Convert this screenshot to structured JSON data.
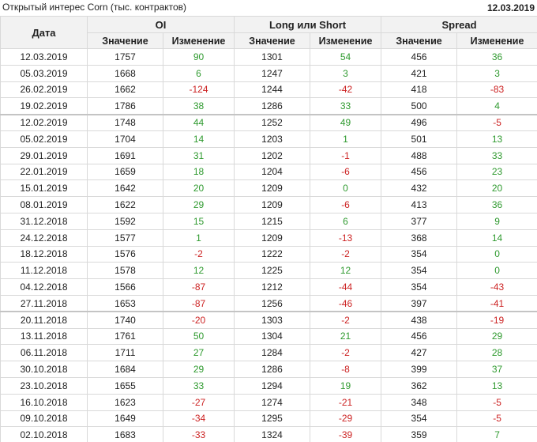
{
  "header": {
    "title": "Открытый интерес Corn (тыс. контрактов)",
    "date": "12.03.2019"
  },
  "columns": {
    "date": "Дата",
    "groups": [
      "OI",
      "Long или Short",
      "Spread"
    ],
    "value": "Значение",
    "change": "Изменение"
  },
  "colors": {
    "positive": "#2f9a2f",
    "negative": "#cc2222",
    "header_bg": "#f2f2f2",
    "grid": "#d9d9d9"
  },
  "group_separators_after_rows": [
    3,
    15
  ],
  "rows": [
    [
      "12.03.2019",
      "1757",
      "90",
      "1301",
      "54",
      "456",
      "36"
    ],
    [
      "05.03.2019",
      "1668",
      "6",
      "1247",
      "3",
      "421",
      "3"
    ],
    [
      "26.02.2019",
      "1662",
      "-124",
      "1244",
      "-42",
      "418",
      "-83"
    ],
    [
      "19.02.2019",
      "1786",
      "38",
      "1286",
      "33",
      "500",
      "4"
    ],
    [
      "12.02.2019",
      "1748",
      "44",
      "1252",
      "49",
      "496",
      "-5"
    ],
    [
      "05.02.2019",
      "1704",
      "14",
      "1203",
      "1",
      "501",
      "13"
    ],
    [
      "29.01.2019",
      "1691",
      "31",
      "1202",
      "-1",
      "488",
      "33"
    ],
    [
      "22.01.2019",
      "1659",
      "18",
      "1204",
      "-6",
      "456",
      "23"
    ],
    [
      "15.01.2019",
      "1642",
      "20",
      "1209",
      "0",
      "432",
      "20"
    ],
    [
      "08.01.2019",
      "1622",
      "29",
      "1209",
      "-6",
      "413",
      "36"
    ],
    [
      "31.12.2018",
      "1592",
      "15",
      "1215",
      "6",
      "377",
      "9"
    ],
    [
      "24.12.2018",
      "1577",
      "1",
      "1209",
      "-13",
      "368",
      "14"
    ],
    [
      "18.12.2018",
      "1576",
      "-2",
      "1222",
      "-2",
      "354",
      "0"
    ],
    [
      "11.12.2018",
      "1578",
      "12",
      "1225",
      "12",
      "354",
      "0"
    ],
    [
      "04.12.2018",
      "1566",
      "-87",
      "1212",
      "-44",
      "354",
      "-43"
    ],
    [
      "27.11.2018",
      "1653",
      "-87",
      "1256",
      "-46",
      "397",
      "-41"
    ],
    [
      "20.11.2018",
      "1740",
      "-20",
      "1303",
      "-2",
      "438",
      "-19"
    ],
    [
      "13.11.2018",
      "1761",
      "50",
      "1304",
      "21",
      "456",
      "29"
    ],
    [
      "06.11.2018",
      "1711",
      "27",
      "1284",
      "-2",
      "427",
      "28"
    ],
    [
      "30.10.2018",
      "1684",
      "29",
      "1286",
      "-8",
      "399",
      "37"
    ],
    [
      "23.10.2018",
      "1655",
      "33",
      "1294",
      "19",
      "362",
      "13"
    ],
    [
      "16.10.2018",
      "1623",
      "-27",
      "1274",
      "-21",
      "348",
      "-5"
    ],
    [
      "09.10.2018",
      "1649",
      "-34",
      "1295",
      "-29",
      "354",
      "-5"
    ],
    [
      "02.10.2018",
      "1683",
      "-33",
      "1324",
      "-39",
      "359",
      "7"
    ]
  ]
}
